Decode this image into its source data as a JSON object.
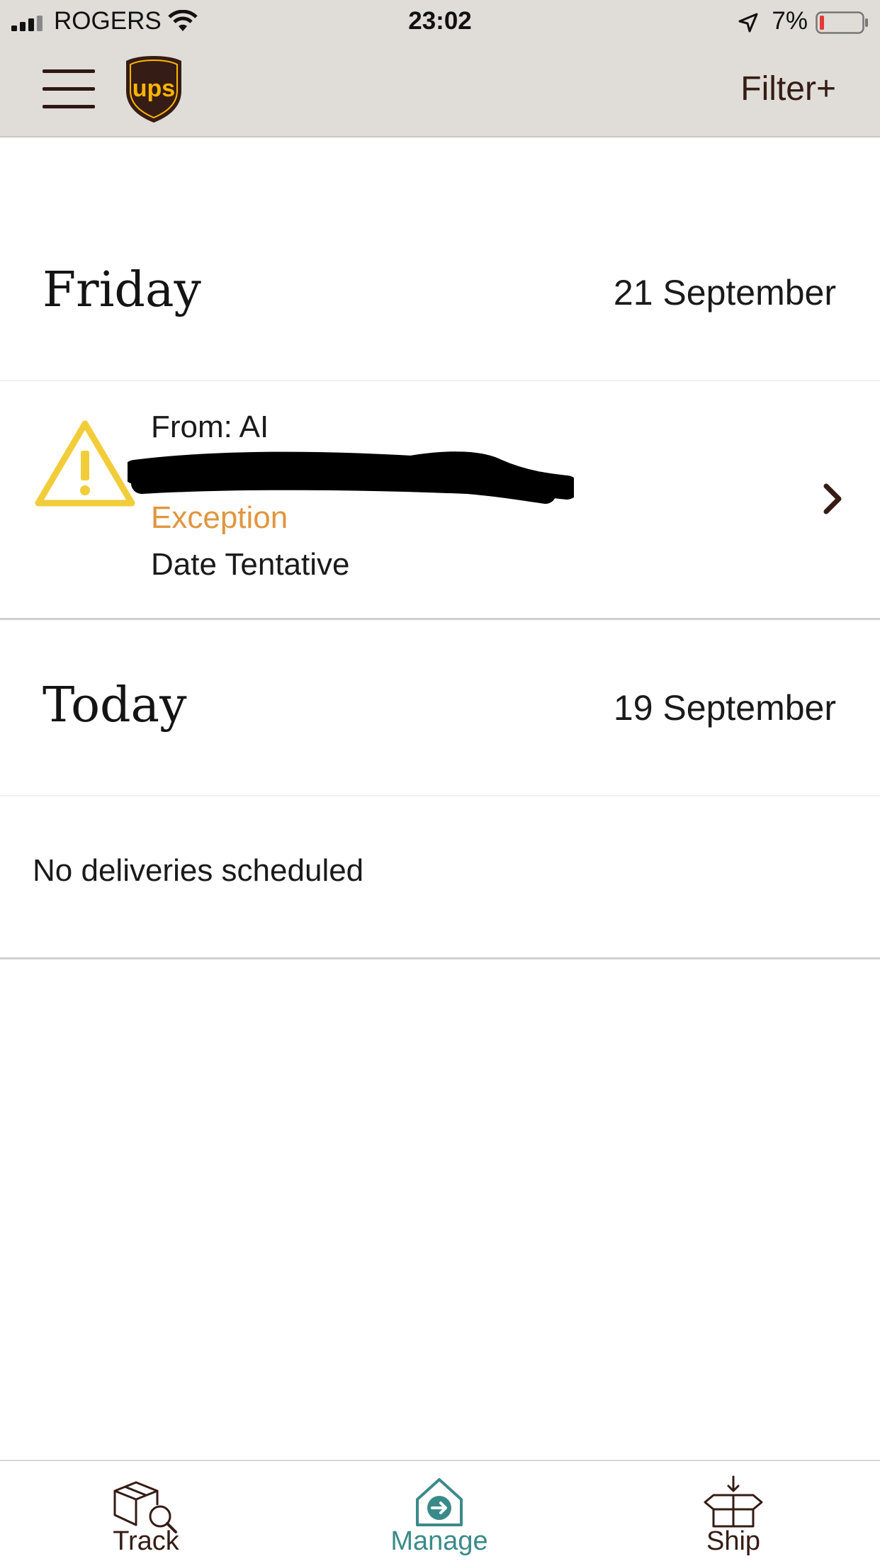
{
  "status_bar": {
    "carrier": "ROGERS",
    "time": "23:02",
    "battery": "7%",
    "icons": [
      "signal-icon",
      "wifi-icon",
      "location-arrow-icon",
      "battery-icon"
    ]
  },
  "header": {
    "logo_text": "ups",
    "filter_label": "Filter+"
  },
  "days": [
    {
      "title": "Friday",
      "date": "21 September",
      "shipment": {
        "from": "From: AI",
        "status": "Exception",
        "date_status": "Date Tentative",
        "icon": "warning-icon"
      }
    },
    {
      "title": "Today",
      "date": "19 September",
      "empty_message": "No deliveries scheduled"
    }
  ],
  "tabs": [
    {
      "label": "Track",
      "icon": "track-package-icon",
      "active": false
    },
    {
      "label": "Manage",
      "icon": "manage-home-icon",
      "active": true
    },
    {
      "label": "Ship",
      "icon": "ship-box-icon",
      "active": false
    }
  ],
  "colors": {
    "brand_brown": "#351c15",
    "brand_gold": "#ffb500",
    "exception_orange": "#e0963e",
    "warning_yellow": "#f2cd3a",
    "active_tab_teal": "#3b8a8a",
    "header_bg": "#e0ddd8"
  }
}
